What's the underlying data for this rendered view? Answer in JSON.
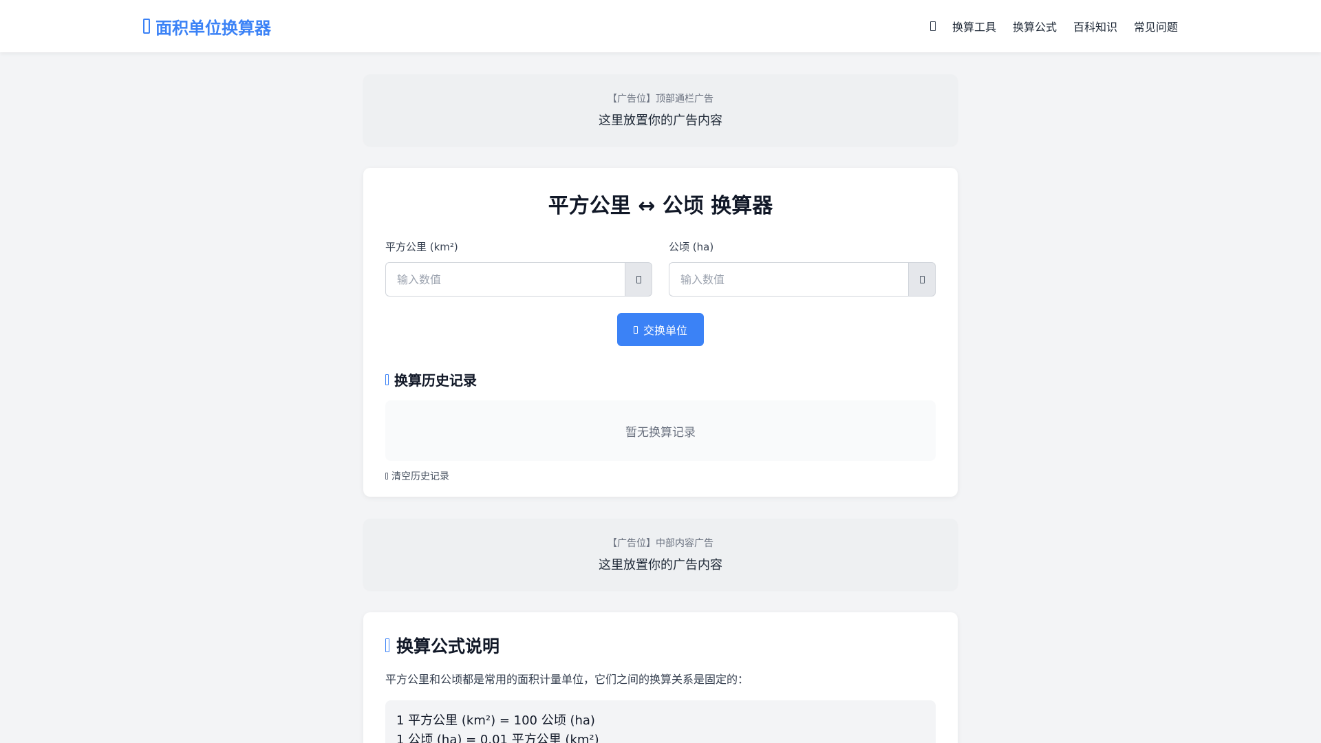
{
  "header": {
    "brand": "面积单位换算器",
    "nav": [
      "换算工具",
      "换算公式",
      "百科知识",
      "常见问题"
    ]
  },
  "ads": {
    "top": {
      "label": "【广告位】顶部通栏广告",
      "content": "这里放置你的广告内容"
    },
    "middle": {
      "label": "【广告位】中部内容广告",
      "content": "这里放置你的广告内容"
    }
  },
  "converter": {
    "title": "平方公里 ↔ 公顷 换算器",
    "left": {
      "label": "平方公里 (km²)",
      "placeholder": "输入数值",
      "value": ""
    },
    "right": {
      "label": "公顷 (ha)",
      "placeholder": "输入数值",
      "value": ""
    },
    "swap_label": "交换单位",
    "history": {
      "title": "换算历史记录",
      "empty": "暂无换算记录",
      "clear_label": "清空历史记录"
    }
  },
  "formula": {
    "title": "换算公式说明",
    "intro": "平方公里和公顷都是常用的面积计量单位，它们之间的换算关系是固定的：",
    "lines": [
      "1 平方公里 (km²) = 100 公顷 (ha)",
      "1 公顷 (ha) = 0.01 平方公里 (km²)"
    ]
  },
  "colors": {
    "accent": "#3b82f6",
    "background": "#f3f4f6",
    "card": "#ffffff"
  },
  "icons": {
    "brand": "calculator-icon",
    "nav": "menu-icon",
    "copy": "copy-icon",
    "swap": "swap-icon",
    "history": "history-icon",
    "clear": "trash-icon",
    "formula": "formula-icon"
  }
}
